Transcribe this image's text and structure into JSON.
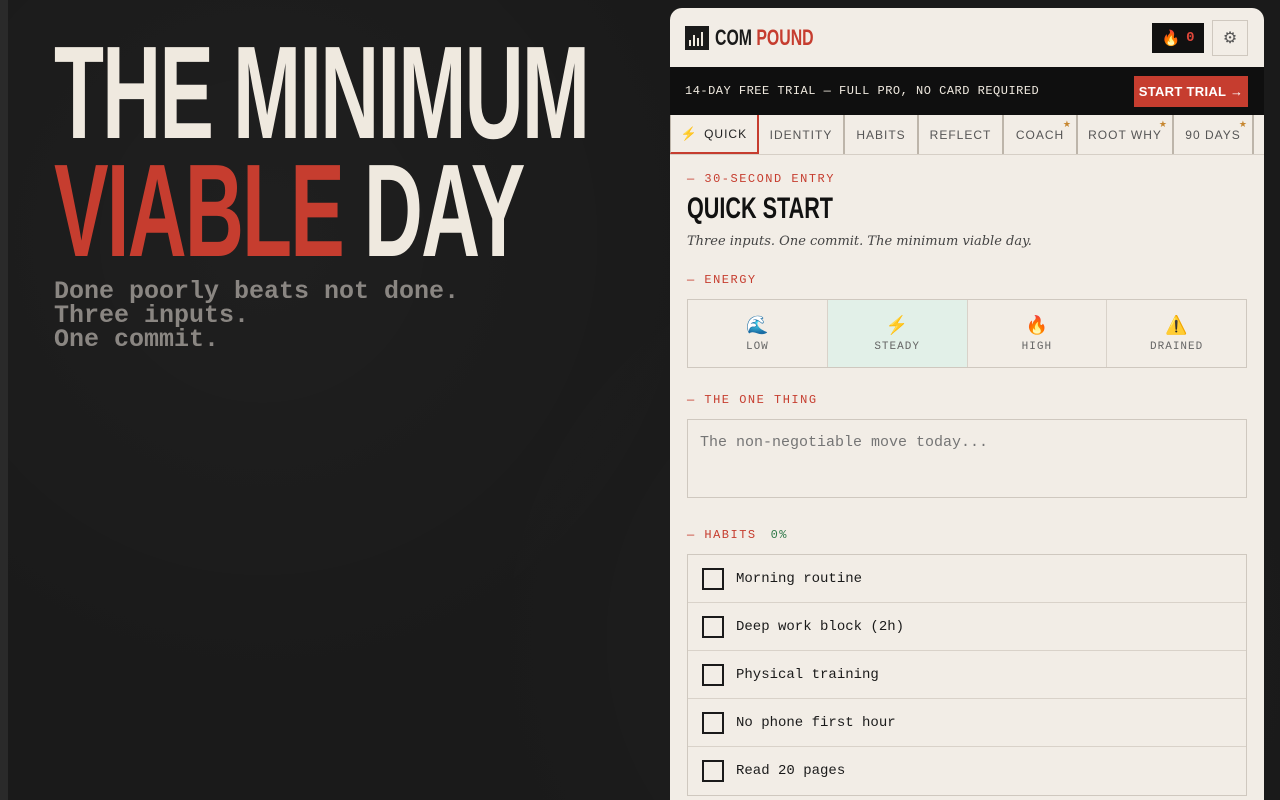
{
  "hero": {
    "line1": "THE MINIMUM",
    "line2_accent": "VIABLE",
    "line2_rest": " DAY",
    "sub": [
      "Done poorly beats not done.",
      "Three inputs.",
      "One commit."
    ]
  },
  "header": {
    "brand_a": "COM",
    "brand_b": "POUND",
    "streak_count": "0",
    "streak_icon": "flame-icon",
    "settings_icon": "gear-icon"
  },
  "trial": {
    "text": "14-DAY FREE TRIAL — FULL PRO, NO CARD REQUIRED",
    "button": "START TRIAL →"
  },
  "tabs": [
    {
      "label": "QUICK",
      "active": true,
      "pro": false
    },
    {
      "label": "IDENTITY",
      "active": false,
      "pro": false
    },
    {
      "label": "HABITS",
      "active": false,
      "pro": false
    },
    {
      "label": "REFLECT",
      "active": false,
      "pro": false
    },
    {
      "label": "COACH",
      "active": false,
      "pro": true
    },
    {
      "label": "ROOT WHY",
      "active": false,
      "pro": true
    },
    {
      "label": "90 DAYS",
      "active": false,
      "pro": true
    }
  ],
  "quick": {
    "eyebrow": "— 30-SECOND ENTRY",
    "title": "QUICK START",
    "description": "Three inputs. One commit. The minimum viable day."
  },
  "energy": {
    "label": "— ENERGY",
    "options": [
      {
        "label": "LOW",
        "icon": "🌊",
        "selected": false
      },
      {
        "label": "STEADY",
        "icon": "⚡",
        "selected": true
      },
      {
        "label": "HIGH",
        "icon": "🔥",
        "selected": false
      },
      {
        "label": "DRAINED",
        "icon": "⚠️",
        "selected": false
      }
    ]
  },
  "one_thing": {
    "label": "— THE ONE THING",
    "placeholder": "The non-negotiable move today..."
  },
  "habits": {
    "label": "— HABITS",
    "percent": "0%",
    "items": [
      "Morning routine",
      "Deep work block (2h)",
      "Physical training",
      "No phone first hour",
      "Read 20 pages"
    ]
  },
  "colors": {
    "accent": "#c63d2f",
    "panel_bg": "#f2ede6",
    "dark_bg": "#1a1a1a",
    "selected_bg": "#e2f0e8"
  }
}
